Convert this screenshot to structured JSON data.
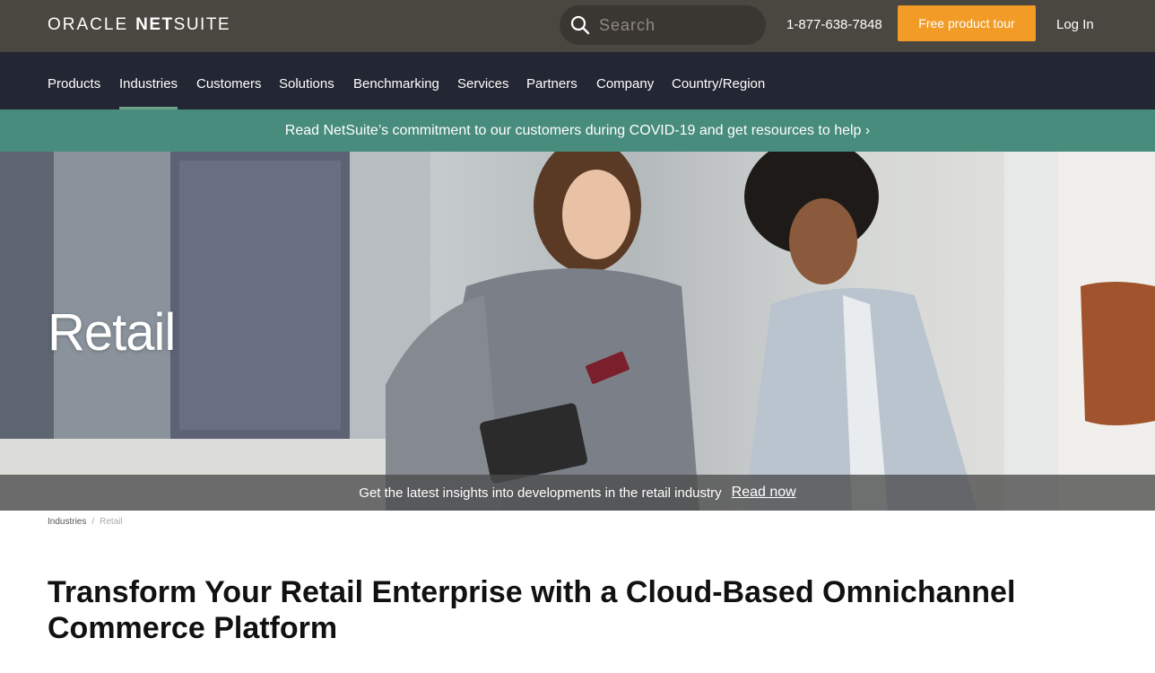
{
  "header": {
    "logo_oracle": "ORACLE",
    "logo_net": "NET",
    "logo_suite": "SUITE",
    "search_placeholder": "Search",
    "search_icon": "search-icon",
    "phone": "1-877-638-7848",
    "cta_label": "Free product tour",
    "login_label": "Log In"
  },
  "nav": {
    "items": [
      "Products",
      "Industries",
      "Customers",
      "Solutions",
      "Benchmarking",
      "Services",
      "Partners",
      "Company",
      "Country/Region"
    ],
    "active": "Industries"
  },
  "covid_banner": "Read NetSuite’s commitment to our customers during COVID-19 and get resources to help ›",
  "hero": {
    "title": "Retail",
    "insight_text": "Get the latest insights into developments in the retail industry",
    "insight_link": "Read now"
  },
  "breadcrumb": {
    "items": [
      "Industries",
      "Retail"
    ],
    "separator": "/"
  },
  "main": {
    "heading": "Transform Your Retail Enterprise with a Cloud-Based Omnichannel Commerce Platform"
  },
  "colors": {
    "topbar": "#4a4640",
    "navbar": "#232633",
    "accent_orange": "#f29b27",
    "covid_banner": "#478c7c",
    "active_underline": "#6fa288"
  }
}
